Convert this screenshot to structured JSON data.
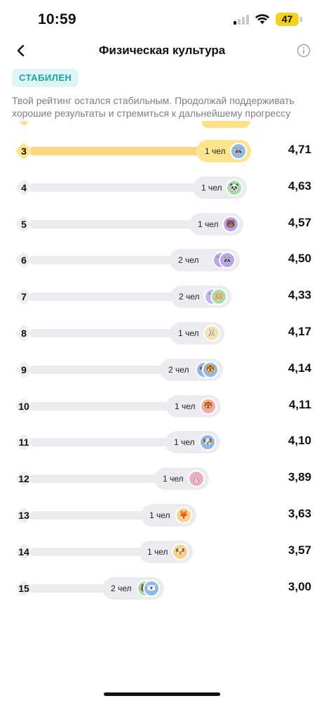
{
  "status": {
    "time": "10:59",
    "battery": "47"
  },
  "header": {
    "title": "Физическая культура",
    "back_icon": "chevron-left-icon",
    "info_icon": "info-circle-icon"
  },
  "badge": {
    "label": "СТАБИЛЕН",
    "color": "#17a6a6"
  },
  "description": "Твой рейтинг остался стабильным. Продолжай поддерживать хорошие результаты и стремиться к дальнейшему прогрессу",
  "colors": {
    "highlight": "#fde58d",
    "bar": "#ececf0"
  },
  "rows": [
    {
      "rank": "3",
      "count": "1 чел",
      "score": "4,71",
      "highlight": true,
      "avatars": [
        {
          "icon": "raccoon-avatar",
          "color": "#8fb8e8",
          "glyph": "🦝"
        }
      ]
    },
    {
      "rank": "4",
      "count": "1 чел",
      "score": "4,63",
      "avatars": [
        {
          "icon": "panda-avatar",
          "color": "#a6dfa6",
          "glyph": "🐼"
        }
      ]
    },
    {
      "rank": "5",
      "count": "1 чел",
      "score": "4,57",
      "avatars": [
        {
          "icon": "bear-avatar",
          "color": "#b9a3f0",
          "glyph": "🐻"
        }
      ]
    },
    {
      "rank": "6",
      "count": "2 чел",
      "score": "4,50",
      "avatars": [
        {
          "icon": "animal-avatar",
          "color": "#b9a3f0",
          "glyph": "🐨"
        },
        {
          "icon": "raccoon-avatar",
          "color": "#b9a3f0",
          "glyph": "🦝"
        }
      ]
    },
    {
      "rank": "7",
      "count": "2 чел",
      "score": "4,33",
      "avatars": [
        {
          "icon": "animal-avatar",
          "color": "#c4b3f2",
          "glyph": "🐨"
        },
        {
          "icon": "hamster-avatar",
          "color": "#a6dfa6",
          "glyph": "🐹"
        }
      ]
    },
    {
      "rank": "8",
      "count": "1 чел",
      "score": "4,17",
      "avatars": [
        {
          "icon": "rabbit-avatar",
          "color": "#f7e3a8",
          "glyph": "🐰"
        }
      ]
    },
    {
      "rank": "9",
      "count": "2 чел",
      "score": "4,14",
      "avatars": [
        {
          "icon": "animal-avatar",
          "color": "#8fb8e8",
          "glyph": "🐶"
        },
        {
          "icon": "tiger-avatar",
          "color": "#8fb8e8",
          "glyph": "🐯"
        }
      ]
    },
    {
      "rank": "10",
      "count": "1 чел",
      "score": "4,11",
      "avatars": [
        {
          "icon": "tiger-avatar",
          "color": "#f3a7b8",
          "glyph": "🐯"
        }
      ]
    },
    {
      "rank": "11",
      "count": "1 чел",
      "score": "4,10",
      "avatars": [
        {
          "icon": "dog-avatar",
          "color": "#8fb8e8",
          "glyph": "🐶"
        }
      ]
    },
    {
      "rank": "12",
      "count": "1 чел",
      "score": "3,89",
      "avatars": [
        {
          "icon": "rabbit-avatar",
          "color": "#f3a7c0",
          "glyph": "🐰"
        }
      ]
    },
    {
      "rank": "13",
      "count": "1 чел",
      "score": "3,63",
      "avatars": [
        {
          "icon": "fox-avatar",
          "color": "#f9d28a",
          "glyph": "🦊"
        }
      ]
    },
    {
      "rank": "14",
      "count": "1 чел",
      "score": "3,57",
      "avatars": [
        {
          "icon": "dog-avatar",
          "color": "#f9d28a",
          "glyph": "🐶"
        }
      ]
    },
    {
      "rank": "15",
      "count": "2 чел",
      "score": "3,00",
      "avatars": [
        {
          "icon": "animal-avatar",
          "color": "#a6dfa6",
          "glyph": "🐻"
        },
        {
          "icon": "bear-avatar",
          "color": "#8fb8e8",
          "glyph": "🐻‍❄️"
        }
      ]
    }
  ]
}
